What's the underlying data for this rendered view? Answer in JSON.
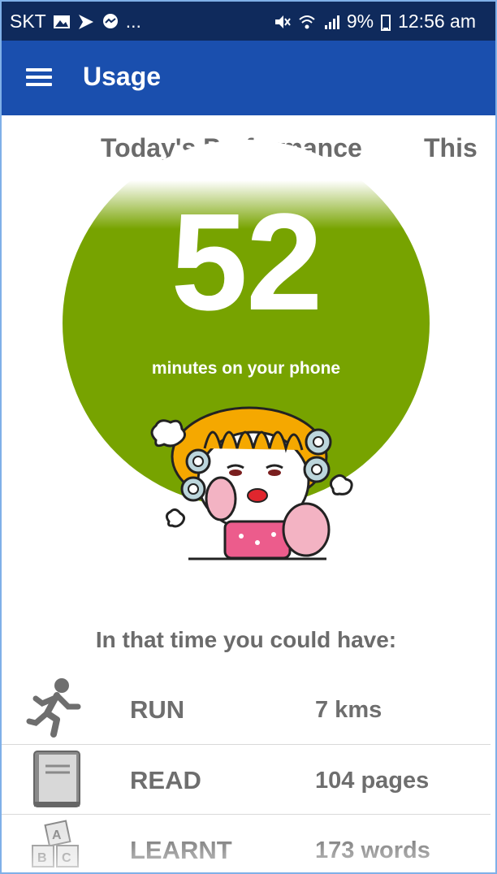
{
  "status_bar": {
    "carrier": "SKT",
    "more": "...",
    "battery": "9%",
    "time": "12:56 am",
    "icons": [
      "image-icon",
      "flipboard-icon",
      "messenger-icon",
      "mute-icon",
      "wifi-icon",
      "signal-icon",
      "battery-icon"
    ]
  },
  "app_bar": {
    "title": "Usage",
    "menu_icon": "hamburger-menu-icon"
  },
  "tabs": [
    "Today's Performance",
    "This"
  ],
  "summary": {
    "minutes": "52",
    "caption": "minutes on your phone",
    "accent_color": "#77a300"
  },
  "subheading": "In that time you could have:",
  "activities": [
    {
      "icon": "running-person-icon",
      "label": "RUN",
      "value": "7 kms"
    },
    {
      "icon": "book-icon",
      "label": "READ",
      "value": "104 pages"
    },
    {
      "icon": "alphabet-blocks-icon",
      "label": "LEARNT",
      "value": "173 words"
    }
  ],
  "colors": {
    "status_bar": "#0f2a5c",
    "app_bar": "#1a4fae",
    "text_gray": "#6b6b6b"
  }
}
